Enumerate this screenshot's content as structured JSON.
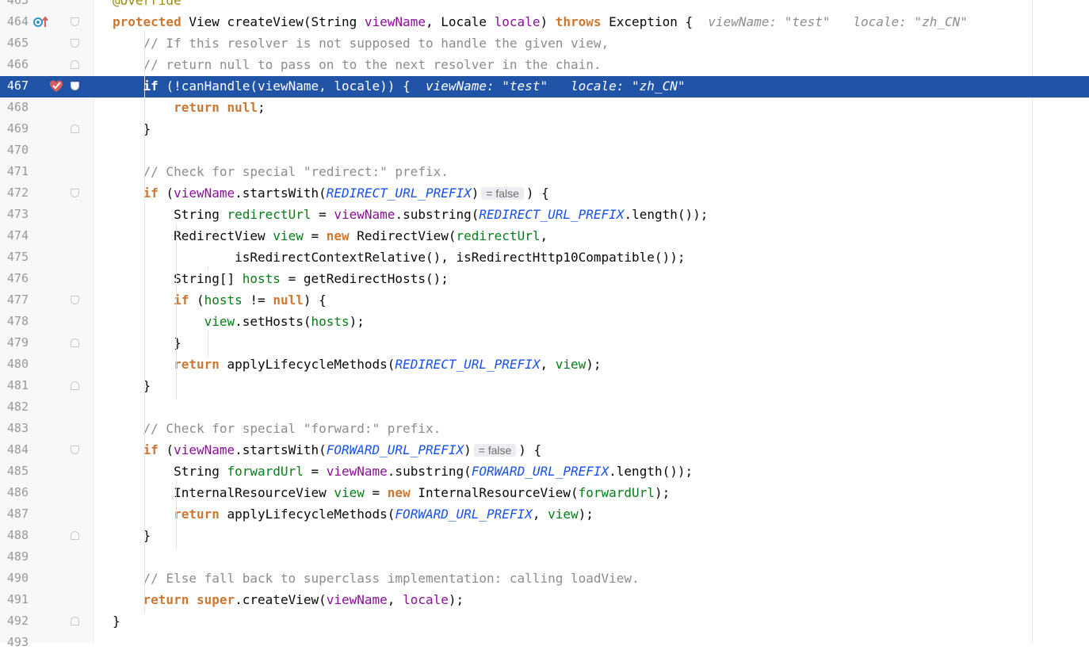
{
  "editor": {
    "top_partial_text": "@Override",
    "current_line": "467",
    "lines": [
      {
        "n": "463",
        "fold": "",
        "tokens": []
      },
      {
        "n": "464",
        "fold": "open",
        "tokens": [
          {
            "t": "protected ",
            "c": "kw"
          },
          {
            "t": "View ",
            "c": "pl"
          },
          {
            "t": "createView",
            "c": "pl"
          },
          {
            "t": "(String ",
            "c": "pl"
          },
          {
            "t": "viewName",
            "c": "pm"
          },
          {
            "t": ", Locale ",
            "c": "pl"
          },
          {
            "t": "locale",
            "c": "pm"
          },
          {
            "t": ") ",
            "c": "pl"
          },
          {
            "t": "throws ",
            "c": "kw"
          },
          {
            "t": "Exception {",
            "c": "pl"
          },
          {
            "t": "  viewName: \"test\"   locale: \"zh_CN\"",
            "c": "hint"
          }
        ]
      },
      {
        "n": "465",
        "fold": "open",
        "tokens": [
          {
            "t": "    // If this resolver is not supposed to handle the given view,",
            "c": "cm"
          }
        ]
      },
      {
        "n": "466",
        "fold": "end",
        "tokens": [
          {
            "t": "    // return null to pass on to the next resolver in the chain.",
            "c": "cm"
          }
        ]
      },
      {
        "n": "467",
        "fold": "open",
        "tokens": [
          {
            "t": "    if ",
            "c": "kw"
          },
          {
            "t": "(!canHandle(viewName, locale)) {",
            "c": "pl"
          },
          {
            "t": "  viewName: \"test\"   locale: \"zh_CN\"",
            "c": "hint"
          }
        ]
      },
      {
        "n": "468",
        "fold": "",
        "tokens": [
          {
            "t": "        return ",
            "c": "kw"
          },
          {
            "t": "null",
            "c": "kw"
          },
          {
            "t": ";",
            "c": "pl"
          }
        ]
      },
      {
        "n": "469",
        "fold": "end",
        "tokens": [
          {
            "t": "    }",
            "c": "pl"
          }
        ]
      },
      {
        "n": "470",
        "fold": "",
        "tokens": []
      },
      {
        "n": "471",
        "fold": "",
        "tokens": [
          {
            "t": "    // Check for special \"redirect:\" prefix.",
            "c": "cm"
          }
        ]
      },
      {
        "n": "472",
        "fold": "open",
        "tokens": [
          {
            "t": "    if ",
            "c": "kw"
          },
          {
            "t": "(",
            "c": "pl"
          },
          {
            "t": "viewName",
            "c": "pm"
          },
          {
            "t": ".startsWith(",
            "c": "pl"
          },
          {
            "t": "REDIRECT_URL_PREFIX",
            "c": "cs"
          },
          {
            "t": ")",
            "c": "pl"
          },
          {
            "t": " = false ",
            "c": "inl"
          },
          {
            "t": ") {",
            "c": "pl"
          }
        ]
      },
      {
        "n": "473",
        "fold": "",
        "tokens": [
          {
            "t": "        String ",
            "c": "pl"
          },
          {
            "t": "redirectUrl",
            "c": "lv"
          },
          {
            "t": " = ",
            "c": "pl"
          },
          {
            "t": "viewName",
            "c": "pm"
          },
          {
            "t": ".substring(",
            "c": "pl"
          },
          {
            "t": "REDIRECT_URL_PREFIX",
            "c": "cs"
          },
          {
            "t": ".length());",
            "c": "pl"
          }
        ]
      },
      {
        "n": "474",
        "fold": "",
        "tokens": [
          {
            "t": "        RedirectView ",
            "c": "pl"
          },
          {
            "t": "view",
            "c": "lv"
          },
          {
            "t": " = ",
            "c": "pl"
          },
          {
            "t": "new ",
            "c": "kw"
          },
          {
            "t": "RedirectView(",
            "c": "pl"
          },
          {
            "t": "redirectUrl",
            "c": "lv"
          },
          {
            "t": ",",
            "c": "pl"
          }
        ]
      },
      {
        "n": "475",
        "fold": "",
        "tokens": [
          {
            "t": "                isRedirectContextRelative(), isRedirectHttp10Compatible());",
            "c": "pl"
          }
        ]
      },
      {
        "n": "476",
        "fold": "",
        "tokens": [
          {
            "t": "        String[] ",
            "c": "pl"
          },
          {
            "t": "hosts",
            "c": "lv"
          },
          {
            "t": " = getRedirectHosts();",
            "c": "pl"
          }
        ]
      },
      {
        "n": "477",
        "fold": "open",
        "tokens": [
          {
            "t": "        if ",
            "c": "kw"
          },
          {
            "t": "(",
            "c": "pl"
          },
          {
            "t": "hosts",
            "c": "lv"
          },
          {
            "t": " != ",
            "c": "pl"
          },
          {
            "t": "null",
            "c": "kw"
          },
          {
            "t": ") {",
            "c": "pl"
          }
        ]
      },
      {
        "n": "478",
        "fold": "",
        "tokens": [
          {
            "t": "            ",
            "c": "pl"
          },
          {
            "t": "view",
            "c": "lv"
          },
          {
            "t": ".setHosts(",
            "c": "pl"
          },
          {
            "t": "hosts",
            "c": "lv"
          },
          {
            "t": ");",
            "c": "pl"
          }
        ]
      },
      {
        "n": "479",
        "fold": "end",
        "tokens": [
          {
            "t": "        }",
            "c": "pl"
          }
        ]
      },
      {
        "n": "480",
        "fold": "",
        "tokens": [
          {
            "t": "        return ",
            "c": "kw"
          },
          {
            "t": "applyLifecycleMethods(",
            "c": "pl"
          },
          {
            "t": "REDIRECT_URL_PREFIX",
            "c": "cs"
          },
          {
            "t": ", ",
            "c": "pl"
          },
          {
            "t": "view",
            "c": "lv"
          },
          {
            "t": ");",
            "c": "pl"
          }
        ]
      },
      {
        "n": "481",
        "fold": "end",
        "tokens": [
          {
            "t": "    }",
            "c": "pl"
          }
        ]
      },
      {
        "n": "482",
        "fold": "",
        "tokens": []
      },
      {
        "n": "483",
        "fold": "",
        "tokens": [
          {
            "t": "    // Check for special \"forward:\" prefix.",
            "c": "cm"
          }
        ]
      },
      {
        "n": "484",
        "fold": "open",
        "tokens": [
          {
            "t": "    if ",
            "c": "kw"
          },
          {
            "t": "(",
            "c": "pl"
          },
          {
            "t": "viewName",
            "c": "pm"
          },
          {
            "t": ".startsWith(",
            "c": "pl"
          },
          {
            "t": "FORWARD_URL_PREFIX",
            "c": "cs"
          },
          {
            "t": ")",
            "c": "pl"
          },
          {
            "t": " = false ",
            "c": "inl"
          },
          {
            "t": ") {",
            "c": "pl"
          }
        ]
      },
      {
        "n": "485",
        "fold": "",
        "tokens": [
          {
            "t": "        String ",
            "c": "pl"
          },
          {
            "t": "forwardUrl",
            "c": "lv"
          },
          {
            "t": " = ",
            "c": "pl"
          },
          {
            "t": "viewName",
            "c": "pm"
          },
          {
            "t": ".substring(",
            "c": "pl"
          },
          {
            "t": "FORWARD_URL_PREFIX",
            "c": "cs"
          },
          {
            "t": ".length());",
            "c": "pl"
          }
        ]
      },
      {
        "n": "486",
        "fold": "",
        "tokens": [
          {
            "t": "        InternalResourceView ",
            "c": "pl"
          },
          {
            "t": "view",
            "c": "lv"
          },
          {
            "t": " = ",
            "c": "pl"
          },
          {
            "t": "new ",
            "c": "kw"
          },
          {
            "t": "InternalResourceView(",
            "c": "pl"
          },
          {
            "t": "forwardUrl",
            "c": "lv"
          },
          {
            "t": ");",
            "c": "pl"
          }
        ]
      },
      {
        "n": "487",
        "fold": "",
        "tokens": [
          {
            "t": "        return ",
            "c": "kw"
          },
          {
            "t": "applyLifecycleMethods(",
            "c": "pl"
          },
          {
            "t": "FORWARD_URL_PREFIX",
            "c": "cs"
          },
          {
            "t": ", ",
            "c": "pl"
          },
          {
            "t": "view",
            "c": "lv"
          },
          {
            "t": ");",
            "c": "pl"
          }
        ]
      },
      {
        "n": "488",
        "fold": "end",
        "tokens": [
          {
            "t": "    }",
            "c": "pl"
          }
        ]
      },
      {
        "n": "489",
        "fold": "",
        "tokens": []
      },
      {
        "n": "490",
        "fold": "",
        "tokens": [
          {
            "t": "    // Else fall back to superclass implementation: calling loadView.",
            "c": "cm"
          }
        ]
      },
      {
        "n": "491",
        "fold": "",
        "tokens": [
          {
            "t": "    return ",
            "c": "kw"
          },
          {
            "t": "super",
            "c": "kw"
          },
          {
            "t": ".createView(",
            "c": "pl"
          },
          {
            "t": "viewName",
            "c": "pm"
          },
          {
            "t": ", ",
            "c": "pl"
          },
          {
            "t": "locale",
            "c": "pm"
          },
          {
            "t": ");",
            "c": "pl"
          }
        ]
      },
      {
        "n": "492",
        "fold": "end",
        "tokens": [
          {
            "t": "}",
            "c": "pl"
          }
        ]
      },
      {
        "n": "493",
        "fold": "",
        "tokens": []
      }
    ]
  },
  "gutter_icons": {
    "line_464": "override-method-icon",
    "line_467": "breakpoint-check-icon"
  },
  "colors": {
    "keyword": "#0033b3",
    "keyword_orange": "#cc7832",
    "param": "#871094",
    "local_var": "#067d17",
    "constant_italic": "#1750eb",
    "comment": "#8c8c8c",
    "inlay_hint": "#8c8c8c",
    "current_line_bg": "#2154a6",
    "breakpoint": "#db5c5c"
  }
}
